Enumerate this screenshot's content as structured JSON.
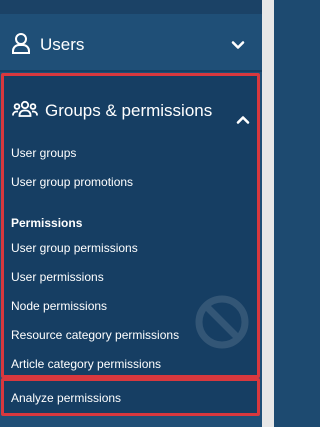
{
  "nav": {
    "users": {
      "label": "Users",
      "icon": "user-icon",
      "state_icon": "chevron-down-icon"
    },
    "groups": {
      "label": "Groups & permissions",
      "icon": "users-group-icon",
      "state_icon": "chevron-up-icon",
      "items": [
        {
          "label": "User groups"
        },
        {
          "label": "User group promotions"
        }
      ],
      "permissions_heading": "Permissions",
      "permission_items": [
        {
          "label": "User group permissions"
        },
        {
          "label": "User permissions"
        },
        {
          "label": "Node permissions"
        },
        {
          "label": "Resource category permissions"
        },
        {
          "label": "Article category permissions"
        }
      ],
      "analyze": {
        "label": "Analyze permissions"
      }
    }
  },
  "colors": {
    "sidebar_bg": "#1f4f77",
    "section_bg": "#163e63",
    "highlight_border": "#d8383e",
    "text": "#ffffff",
    "scroll_track": "#e7e7e7"
  }
}
